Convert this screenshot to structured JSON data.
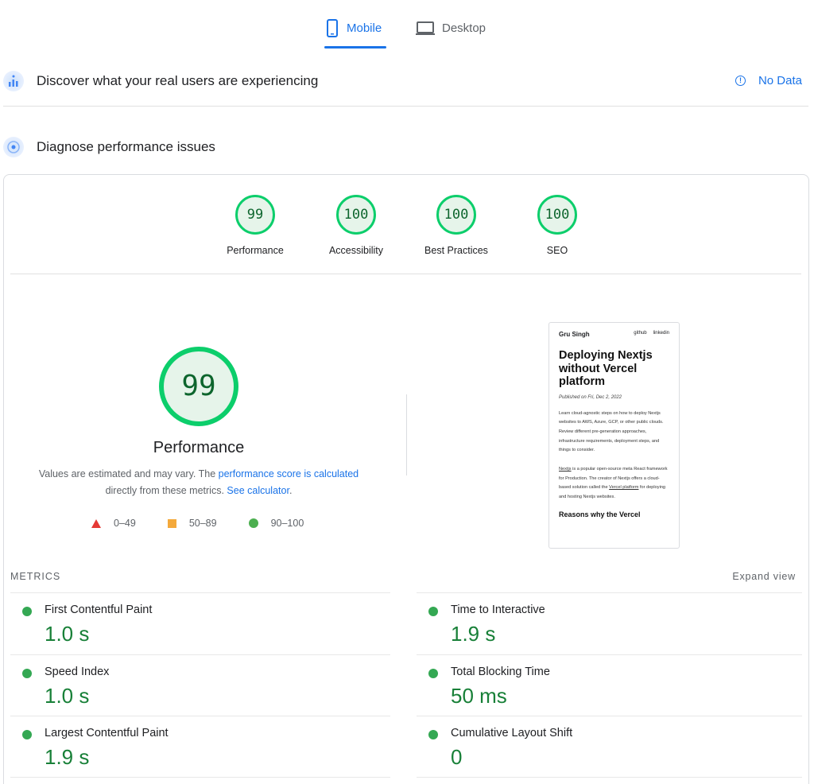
{
  "tabs": {
    "mobile_label": "Mobile",
    "desktop_label": "Desktop",
    "active": "Mobile"
  },
  "field_data": {
    "title": "Discover what your real users are experiencing",
    "status": "No Data"
  },
  "lab_data": {
    "title": "Diagnose performance issues"
  },
  "category_scores": [
    {
      "label": "Performance",
      "score": "99"
    },
    {
      "label": "Accessibility",
      "score": "100"
    },
    {
      "label": "Best Practices",
      "score": "100"
    },
    {
      "label": "SEO",
      "score": "100"
    }
  ],
  "performance": {
    "score": "99",
    "title": "Performance",
    "desc_prefix": "Values are estimated and may vary. The ",
    "desc_link": "performance score is calculated",
    "desc_middle": " directly from these metrics. ",
    "desc_link2": "See calculator",
    "desc_suffix": "."
  },
  "legend": [
    {
      "shape": "triangle",
      "range": "0–49",
      "color": "#e53935"
    },
    {
      "shape": "square",
      "range": "50–89",
      "color": "#f4a93b"
    },
    {
      "shape": "circle",
      "range": "90–100",
      "color": "#4caf50"
    }
  ],
  "screenshot": {
    "author": "Gru Singh",
    "link1": "github",
    "link2": "linkedin",
    "title": "Deploying Nextjs without Vercel platform",
    "date": "Published on Fri, Dec 2, 2022",
    "para1": "Learn cloud-agnostic steps on how to deploy Nextjs websites to AWS, Azure, GCP, or other public clouds. Review different pre-generation approaches, infrastructure requirements, deployment steps, and things to consider.",
    "para2_link1": "Nextjs",
    "para2_text1": " is a popular open-source meta React framework for Production. The creator of Nextjs offers a cloud-based solution called the ",
    "para2_link2": "Vercel platform",
    "para2_text2": " for deploying and hosting Nextjs websites.",
    "heading": "Reasons why the Vercel"
  },
  "metrics": {
    "header": "METRICS",
    "expand_label": "Expand view",
    "left": [
      {
        "name": "First Contentful Paint",
        "value": "1.0 s"
      },
      {
        "name": "Speed Index",
        "value": "1.0 s"
      },
      {
        "name": "Largest Contentful Paint",
        "value": "1.9 s"
      }
    ],
    "right": [
      {
        "name": "Time to Interactive",
        "value": "1.9 s"
      },
      {
        "name": "Total Blocking Time",
        "value": "50 ms"
      },
      {
        "name": "Cumulative Layout Shift",
        "value": "0"
      }
    ]
  },
  "colors": {
    "accent": "#1a73e8",
    "pass_green": "#0cce6b",
    "pass_fill": "#e6f4ea"
  }
}
